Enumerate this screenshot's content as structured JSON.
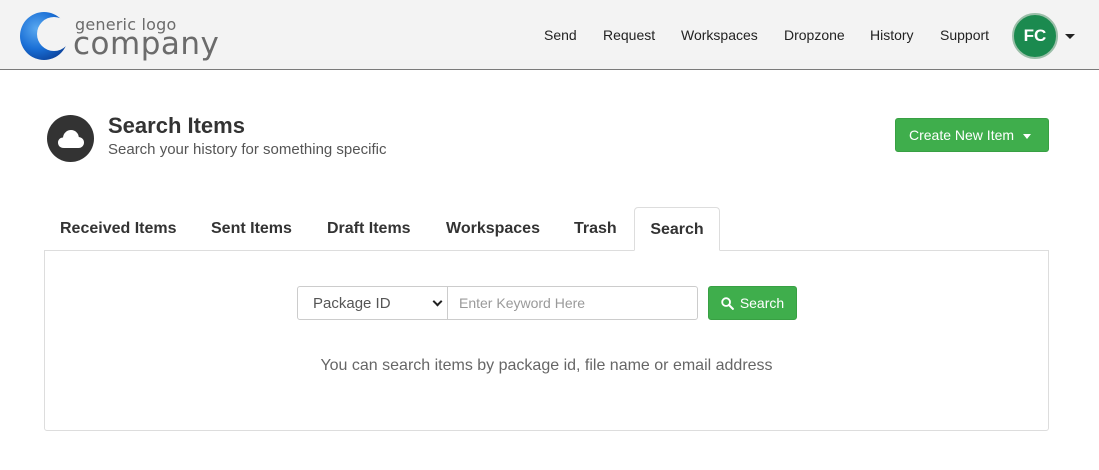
{
  "header": {
    "logo": {
      "small_text": "generic logo",
      "big_text": "company"
    },
    "nav": [
      {
        "label": "Send"
      },
      {
        "label": "Request"
      },
      {
        "label": "Workspaces"
      },
      {
        "label": "Dropzone"
      },
      {
        "label": "History"
      },
      {
        "label": "Support"
      }
    ],
    "user": {
      "initials": "FC"
    }
  },
  "page": {
    "icon": "cloud-icon",
    "title": "Search Items",
    "subtitle": "Search your history for something specific",
    "create_button": "Create New Item"
  },
  "tabs": [
    {
      "label": "Received Items"
    },
    {
      "label": "Sent Items"
    },
    {
      "label": "Draft Items"
    },
    {
      "label": "Workspaces"
    },
    {
      "label": "Trash"
    },
    {
      "label": "Search",
      "active": true
    }
  ],
  "search": {
    "field_selected": "Package ID",
    "keyword_placeholder": "Enter Keyword Here",
    "keyword_value": "",
    "button_label": "Search",
    "hint": "You can search items by package id, file name or email address"
  },
  "colors": {
    "accent_green": "#3fae4c",
    "avatar_green": "#1b8a4f",
    "header_bg": "#f3f3f3",
    "logo_blue": "#1565c0"
  }
}
